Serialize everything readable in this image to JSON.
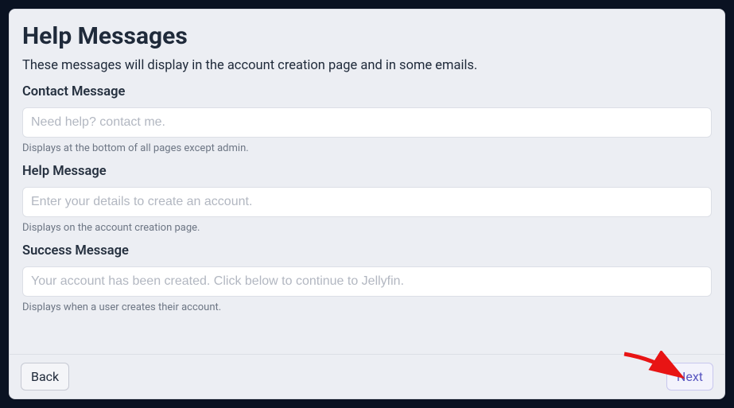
{
  "title": "Help Messages",
  "subtitle": "These messages will display in the account creation page and in some emails.",
  "fields": {
    "contact": {
      "label": "Contact Message",
      "placeholder": "Need help? contact me.",
      "value": "",
      "hint": "Displays at the bottom of all pages except admin."
    },
    "help": {
      "label": "Help Message",
      "placeholder": "Enter your details to create an account.",
      "value": "",
      "hint": "Displays on the account creation page."
    },
    "success": {
      "label": "Success Message",
      "placeholder": "Your account has been created. Click below to continue to Jellyfin.",
      "value": "",
      "hint": "Displays when a user creates their account."
    }
  },
  "buttons": {
    "back": "Back",
    "next": "Next"
  }
}
